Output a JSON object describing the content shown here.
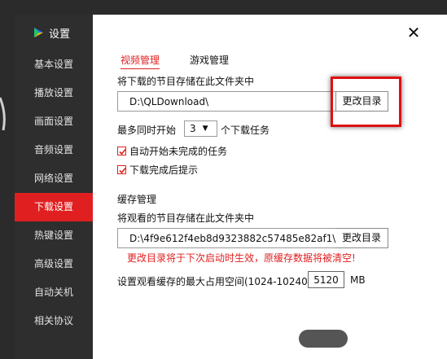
{
  "app": {
    "title": "设置",
    "close_icon": "close-icon"
  },
  "sidebar": {
    "items": [
      {
        "label": "基本设置",
        "active": false
      },
      {
        "label": "播放设置",
        "active": false
      },
      {
        "label": "画面设置",
        "active": false
      },
      {
        "label": "音频设置",
        "active": false
      },
      {
        "label": "网络设置",
        "active": false
      },
      {
        "label": "下载设置",
        "active": true
      },
      {
        "label": "热键设置",
        "active": false
      },
      {
        "label": "高级设置",
        "active": false
      },
      {
        "label": "自动关机",
        "active": false
      },
      {
        "label": "相关协议",
        "active": false
      }
    ]
  },
  "tabs": [
    {
      "label": "视频管理",
      "active": true
    },
    {
      "label": "游戏管理",
      "active": false
    }
  ],
  "download": {
    "folder_label": "将下载的节目存储在此文件夹中",
    "folder_path": "D:\\QLDownload\\",
    "change_button": "更改目录",
    "max_prefix": "最多同时开始",
    "max_value": "3",
    "max_suffix": "个下载任务",
    "auto_start_label": "自动开始未完成的任务",
    "auto_start_checked": true,
    "notify_label": "下载完成后提示",
    "notify_checked": true
  },
  "cache": {
    "section_title": "缓存管理",
    "folder_label": "将观看的节目存储在此文件夹中",
    "folder_path": "D:\\4f9e612f4eb8d9323882c57485e82af1\\",
    "change_button": "更改目录",
    "warning": "更改目录将于下次启动时生效，原缓存数据将被清空!",
    "max_space_label": "设置观看缓存的最大占用空间(1024-10240)",
    "max_space_value": "5120",
    "unit": "MB"
  },
  "colors": {
    "accent": "#e02020",
    "sidebar_bg": "#2e2e2e"
  }
}
